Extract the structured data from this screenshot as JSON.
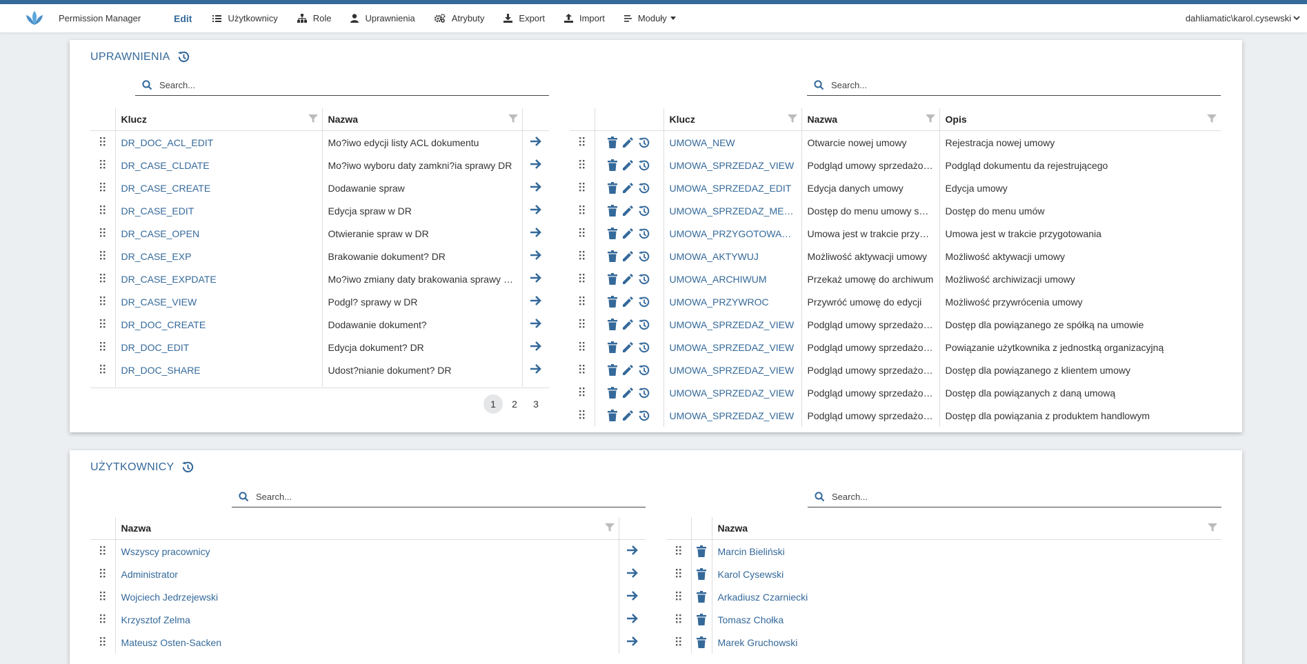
{
  "navbar": {
    "app_title": "Permission Manager",
    "edit_label": "Edit",
    "items": [
      {
        "label": "Użytkownicy",
        "icon": "list-icon"
      },
      {
        "label": "Role",
        "icon": "sitemap-icon"
      },
      {
        "label": "Uprawnienia",
        "icon": "user-icon"
      },
      {
        "label": "Atrybuty",
        "icon": "cogs-icon"
      },
      {
        "label": "Export",
        "icon": "download-icon"
      },
      {
        "label": "Import",
        "icon": "upload-icon"
      },
      {
        "label": "Moduły",
        "icon": "menu-icon"
      }
    ],
    "user": "dahliamatic\\karol.cysewski"
  },
  "colors": {
    "accent": "#34699a",
    "background": "#eceff2",
    "stripe": "#34699a"
  },
  "uprawnienia": {
    "title": "UPRAWNIENIA",
    "left_search_placeholder": "Search...",
    "right_search_placeholder": "Search...",
    "left_headers": {
      "klucz": "Klucz",
      "nazwa": "Nazwa"
    },
    "left_rows": [
      {
        "klucz": "DR_DOC_ACL_EDIT",
        "nazwa": "Mo?iwo edycji listy ACL dokumentu"
      },
      {
        "klucz": "DR_CASE_CLDATE",
        "nazwa": "Mo?iwo wyboru daty zamkni?ia sprawy DR"
      },
      {
        "klucz": "DR_CASE_CREATE",
        "nazwa": "Dodawanie spraw"
      },
      {
        "klucz": "DR_CASE_EDIT",
        "nazwa": "Edycja spraw w DR"
      },
      {
        "klucz": "DR_CASE_OPEN",
        "nazwa": "Otwieranie spraw w DR"
      },
      {
        "klucz": "DR_CASE_EXP",
        "nazwa": "Brakowanie dokument? DR"
      },
      {
        "klucz": "DR_CASE_EXPDATE",
        "nazwa": "Mo?iwo zmiany daty brakowania sprawy DR"
      },
      {
        "klucz": "DR_CASE_VIEW",
        "nazwa": "Podgl? sprawy w DR"
      },
      {
        "klucz": "DR_DOC_CREATE",
        "nazwa": "Dodawanie dokument?"
      },
      {
        "klucz": "DR_DOC_EDIT",
        "nazwa": "Edycja dokument? DR"
      },
      {
        "klucz": "DR_DOC_SHARE",
        "nazwa": "Udost?nianie dokument? DR"
      }
    ],
    "pages": [
      "1",
      "2",
      "3"
    ],
    "active_page": "1",
    "right_headers": {
      "klucz": "Klucz",
      "nazwa": "Nazwa",
      "opis": "Opis"
    },
    "right_rows": [
      {
        "klucz": "UMOWA_NEW",
        "nazwa": "Otwarcie nowej umowy",
        "opis": "Rejestracja nowej umowy"
      },
      {
        "klucz": "UMOWA_SPRZEDAZ_VIEW",
        "nazwa": "Podgląd umowy sprzedażo…",
        "opis": "Podgląd dokumentu da rejestrującego"
      },
      {
        "klucz": "UMOWA_SPRZEDAZ_EDIT",
        "nazwa": "Edycja danych umowy",
        "opis": "Edycja umowy"
      },
      {
        "klucz": "UMOWA_SPRZEDAZ_ME…",
        "nazwa": "Dostęp do menu umowy sp…",
        "opis": "Dostęp do menu umów"
      },
      {
        "klucz": "UMOWA_PRZYGOTOWA…",
        "nazwa": "Umowa jest w trakcie przyg…",
        "opis": "Umowa jest w trakcie przygotowania"
      },
      {
        "klucz": "UMOWA_AKTYWUJ",
        "nazwa": "Możliwość aktywacji umowy",
        "opis": "Możliwość aktywacji umowy"
      },
      {
        "klucz": "UMOWA_ARCHIWUM",
        "nazwa": "Przekaż umowę do archiwum",
        "opis": "Możliwość archiwizacji umowy"
      },
      {
        "klucz": "UMOWA_PRZYWROC",
        "nazwa": "Przywróć umowę do edycji",
        "opis": "Możliwość przywrócenia umowy"
      },
      {
        "klucz": "UMOWA_SPRZEDAZ_VIEW",
        "nazwa": "Podgląd umowy sprzedażo…",
        "opis": "Dostęp dla powiązanego ze spółką na umowie"
      },
      {
        "klucz": "UMOWA_SPRZEDAZ_VIEW",
        "nazwa": "Podgląd umowy sprzedażo…",
        "opis": "Powiązanie użytkownika z jednostką organizacyjną"
      },
      {
        "klucz": "UMOWA_SPRZEDAZ_VIEW",
        "nazwa": "Podgląd umowy sprzedażo…",
        "opis": "Dostęp dla powiązanego z klientem umowy"
      },
      {
        "klucz": "UMOWA_SPRZEDAZ_VIEW",
        "nazwa": "Podgląd umowy sprzedażo…",
        "opis": "Dostęp dla powiązanych z daną umową"
      },
      {
        "klucz": "UMOWA_SPRZEDAZ_VIEW",
        "nazwa": "Podgląd umowy sprzedażo…",
        "opis": "Dostęp dla powiązania z produktem handlowym"
      }
    ]
  },
  "uzytkownicy": {
    "title": "UŻYTKOWNICY",
    "left_search_placeholder": "Search...",
    "right_search_placeholder": "Search...",
    "left_header": "Nazwa",
    "right_header": "Nazwa",
    "left_rows": [
      "Wszyscy pracownicy",
      "Administrator",
      "Wojciech Jedrzejewski",
      "Krzysztof Zelma",
      "Mateusz Osten-Sacken"
    ],
    "right_rows": [
      "Marcin Bieliński",
      "Karol Cysewski",
      "Arkadiusz Czarniecki",
      "Tomasz Chołka",
      "Marek Gruchowski"
    ]
  }
}
